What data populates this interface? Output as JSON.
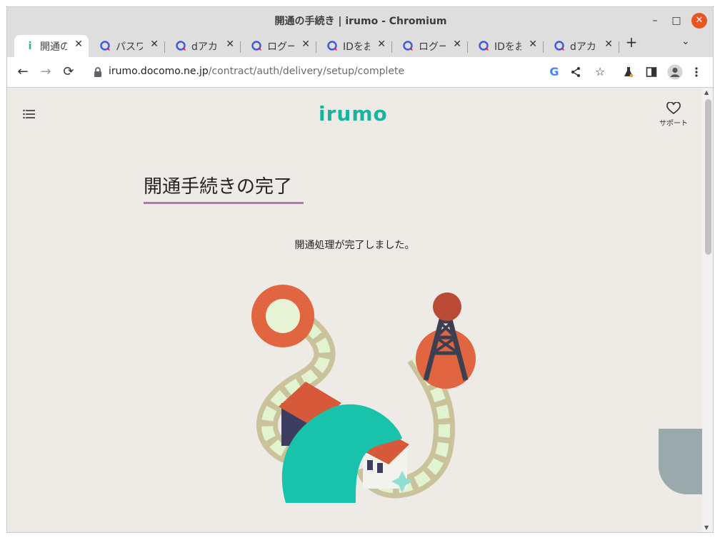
{
  "window": {
    "title": "開通の手続き | irumo - Chromium",
    "minimize": "–",
    "maximize": "□",
    "close": "✕"
  },
  "tabs": [
    {
      "label": "開通の",
      "icon": "irumo-favicon",
      "active": true
    },
    {
      "label": "パスワ",
      "icon": "docomo-favicon"
    },
    {
      "label": "dアカ",
      "icon": "docomo-favicon"
    },
    {
      "label": "ログー",
      "icon": "docomo-favicon"
    },
    {
      "label": "IDをお",
      "icon": "docomo-favicon"
    },
    {
      "label": "ログー",
      "icon": "docomo-favicon"
    },
    {
      "label": "IDをお",
      "icon": "docomo-favicon"
    },
    {
      "label": "dアカ",
      "icon": "docomo-favicon"
    }
  ],
  "tab_close": "✕",
  "new_tab": "+",
  "tab_menu": "⌄",
  "toolbar": {
    "back": "←",
    "forward": "→",
    "reload": "⟳"
  },
  "address": {
    "domain": "irumo.docomo.ne.jp",
    "path": "/contract/auth/delivery/setup/complete"
  },
  "omni_icons": {
    "google": "G",
    "share": "share-icon",
    "bookmark": "☆"
  },
  "page": {
    "logo": "irumo",
    "support_label": "サポート",
    "heading": "開通手続きの完了",
    "message": "開通処理が完了しました。"
  },
  "colors": {
    "accent": "#19b39f",
    "heading_underline": "#b077b4",
    "close": "#e95420",
    "box_border": "#c0143c"
  }
}
